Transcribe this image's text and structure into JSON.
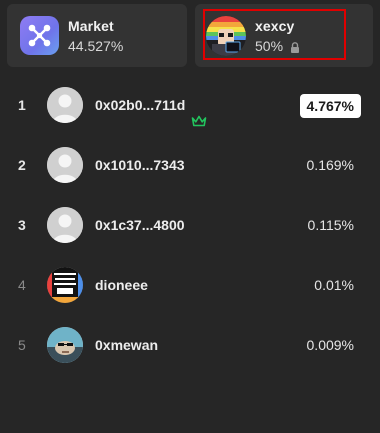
{
  "cards": {
    "market": {
      "title": "Market",
      "value": "44.527%",
      "icon": "market-logo-icon"
    },
    "self": {
      "title": "xexcy",
      "value": "50%",
      "icon": "lock-icon",
      "highlight_color": "#e00000"
    }
  },
  "leaderboard": [
    {
      "rank": "1",
      "name": "0x02b0...711d",
      "percent": "4.767%",
      "badge": "crown-icon",
      "highlighted": true
    },
    {
      "rank": "2",
      "name": "0x1010...7343",
      "percent": "0.169%"
    },
    {
      "rank": "3",
      "name": "0x1c37...4800",
      "percent": "0.115%"
    },
    {
      "rank": "4",
      "name": "dioneee",
      "percent": "0.01%"
    },
    {
      "rank": "5",
      "name": "0xmewan",
      "percent": "0.009%"
    }
  ],
  "colors": {
    "background": "#262626",
    "card": "#333333",
    "accent_green": "#22c55e",
    "badge_bg": "#ffffff"
  }
}
